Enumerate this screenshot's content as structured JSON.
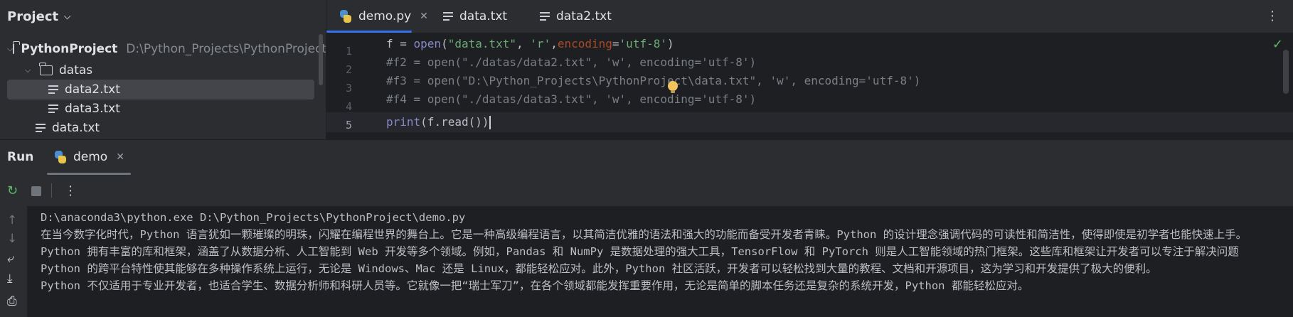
{
  "project": {
    "title": "Project",
    "items": [
      {
        "label": "PythonProject",
        "path": "D:\\Python_Projects\\PythonProject"
      },
      {
        "label": "datas"
      },
      {
        "label": "data2.txt"
      },
      {
        "label": "data3.txt"
      },
      {
        "label": "data.txt"
      }
    ]
  },
  "editor": {
    "tabs": [
      {
        "label": "demo.py",
        "icon": "python-file-icon"
      },
      {
        "label": "data.txt",
        "icon": "text-file-icon"
      },
      {
        "label": "data2.txt",
        "icon": "text-file-icon"
      }
    ],
    "line_numbers": [
      "1",
      "2",
      "3",
      "4",
      "5"
    ],
    "code": {
      "l1": {
        "a": "f = ",
        "b": "open",
        "c": "(",
        "d": "\"data.txt\"",
        "e": ", ",
        "f": "'r'",
        "g": ",",
        "h": "encoding",
        "i": "=",
        "j": "'utf-8'",
        "k": ")"
      },
      "l2": "#f2 = open(\"./datas/data2.txt\", 'w', encoding='utf-8')",
      "l3": "#f3 = open(\"D:\\Python_Projects\\PythonProject\\data.txt\", 'w', encoding='utf-8')",
      "l4": "#f4 = open(\"./datas/data3.txt\", 'w', encoding='utf-8')",
      "l5": {
        "a": "print",
        "b": "(f.read())"
      }
    }
  },
  "run": {
    "title": "Run",
    "tab_label": "demo",
    "console": [
      "D:\\anaconda3\\python.exe D:\\Python_Projects\\PythonProject\\demo.py",
      "在当今数字化时代，Python 语言犹如一颗璀璨的明珠，闪耀在编程世界的舞台上。它是一种高级编程语言，以其简洁优雅的语法和强大的功能而备受开发者青睐。Python 的设计理念强调代码的可读性和简洁性，使得即使是初学者也能快速上手。",
      "Python 拥有丰富的库和框架，涵盖了从数据分析、人工智能到 Web 开发等多个领域。例如，Pandas 和 NumPy 是数据处理的强大工具，TensorFlow 和 PyTorch 则是人工智能领域的热门框架。这些库和框架让开发者可以专注于解决问题",
      "Python 的跨平台特性使其能够在多种操作系统上运行，无论是 Windows、Mac 还是 Linux，都能轻松应对。此外，Python 社区活跃，开发者可以轻松找到大量的教程、文档和开源项目，这为学习和开发提供了极大的便利。",
      "Python 不仅适用于专业开发者，也适合学生、数据分析师和科研人员等。它就像一把“瑞士军刀”，在各个领域都能发挥重要作用，无论是简单的脚本任务还是复杂的系统开发，Python 都能轻松应对。"
    ]
  },
  "colors": {
    "accent": "#3574f0",
    "string": "#6aab73",
    "keyword_arg": "#aa4926",
    "builtin": "#8888c6",
    "comment": "#7a7e85",
    "success": "#5fb865"
  }
}
